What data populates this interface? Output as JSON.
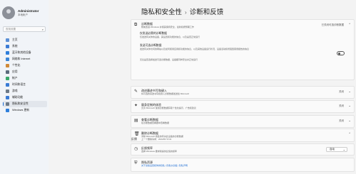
{
  "user": {
    "name": "Administrator",
    "account": "本地帐户"
  },
  "search": {
    "placeholder": "查找设置"
  },
  "sidebar": {
    "items": [
      {
        "label": "主页",
        "color": "#5a8fd6"
      },
      {
        "label": "系统",
        "color": "#3a7bd5"
      },
      {
        "label": "蓝牙和其他设备",
        "color": "#2f7fdb"
      },
      {
        "label": "网络和 Internet",
        "color": "#3c86d8"
      },
      {
        "label": "个性化",
        "color": "#d08a38"
      },
      {
        "label": "应用",
        "color": "#5c6b7d"
      },
      {
        "label": "帐户",
        "color": "#3aa86b"
      },
      {
        "label": "时间和语言",
        "color": "#3a7bd5"
      },
      {
        "label": "游戏",
        "color": "#6d7a88"
      },
      {
        "label": "辅助功能",
        "color": "#3a7bd5"
      },
      {
        "label": "隐私和安全性",
        "color": "#6d7a88"
      },
      {
        "label": "Windows 更新",
        "color": "#2f7fdb"
      }
    ]
  },
  "breadcrumb": {
    "parent": "隐私和安全性",
    "separator": "›",
    "current": "诊断和反馈"
  },
  "cards": {
    "diagnostic": {
      "title": "诊断数据",
      "desc": "帮助改进 Windows 并使其保持安全、最新和按预期工作",
      "value": "已关闭可选诊断数据",
      "icon": "⧉"
    },
    "inking": {
      "title": "改进墨迹书写和键入",
      "desc": "将可选的墨迹书写和键入诊断数据发送给 Microsoft",
      "value": "关闭",
      "icon": "✎"
    },
    "tailored": {
      "title": "量身定制的体验",
      "desc": "允许 Microsoft 使用诊断数据获取个性化提示、广告和建议",
      "value": "关闭",
      "icon": "✦"
    },
    "viewer": {
      "title": "查看诊断数据",
      "desc": "在诊断数据查看器中查看数据",
      "value": "关闭",
      "icon": "▤"
    },
    "delete": {
      "title": "删除诊断数据",
      "desc": "清除 Microsoft 收集的有关此设备的诊断数据",
      "status": "上一个删除请求：2024/5/7 8:31",
      "icon": "🗑"
    },
    "frequency": {
      "title": "反馈频率",
      "desc": "选择 Windows 要求我提供反馈的频率",
      "value": "自动",
      "icon": "◷"
    },
    "privacy": {
      "title": "隐私资源",
      "links": "关于这些设置和你的隐私  |  隐私仪表板  |  隐私声明",
      "icon": "⛨"
    }
  },
  "subs": {
    "required": {
      "title": "仅发送必需的诊断数据",
      "desc": "仅发送有关你的设备、其设置和功能的信息，以及是否正常运行"
    },
    "optional": {
      "title": "发送可选诊断数据",
      "desc": "发送有关你访问的网站以及如何使用应用和功能的信息，以及其他设备运行状况、设备活动和增强型错误报告的信息"
    },
    "note": "无论是否选择发送可选诊断数据，设备都同样安全并正常运行"
  },
  "section": {
    "feedback": "反馈"
  }
}
